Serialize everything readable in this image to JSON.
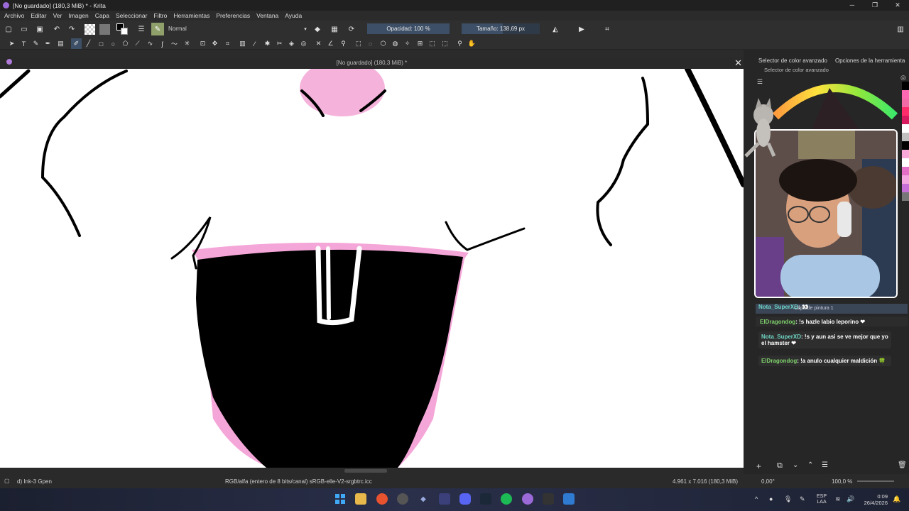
{
  "window": {
    "title": "[No guardado]  (180,3 MiB) * - Krita",
    "minimize": "─",
    "maximize": "❐",
    "close": "✕"
  },
  "menu": [
    "Archivo",
    "Editar",
    "Ver",
    "Imagen",
    "Capa",
    "Seleccionar",
    "Filtro",
    "Herramientas",
    "Preferencias",
    "Ventana",
    "Ayuda"
  ],
  "toolbar": {
    "blend_mode": "Normal",
    "opacity_label": "Opacidad: 100 %",
    "size_label": "Tamaño: 138,69 px"
  },
  "document": {
    "title": "[No guardado]  (180,3 MiB) *",
    "close": "✕"
  },
  "panel": {
    "tab_color": "Selector de color avanzado",
    "tab_tool_options": "Opciones de la herramienta",
    "docker_title": "Selector de color avanzado",
    "layer_name": "Capa de pintura 1"
  },
  "chat": [
    {
      "user": "Nota_SuperXD",
      "text": ": 👀"
    },
    {
      "user": "ElDragondog",
      "text": ": !s hazle labio leporino ❤"
    },
    {
      "user": "Nota_SuperXD",
      "text": ": !s y aun asi se ve mejor que yo el hamster ❤"
    },
    {
      "user": "ElDragondog",
      "text": ": !a anulo cualquier maldición 🍀"
    }
  ],
  "status": {
    "brush": "d) Ink-3 Gpen",
    "color_space": "RGB/alfa (entero de 8 bits/canal)  sRGB-elle-V2-srgbtrc.icc",
    "dimensions": "4.961 x 7.016 (180,3 MiB)",
    "rotation": "0,00°",
    "zoom": "100,0 %"
  },
  "taskbar": {
    "lang1": "ESP",
    "lang2": "LAA",
    "time": "0:09",
    "date": "26/4/2026"
  },
  "colors": {
    "accent": "#3d4f66",
    "pink": "#f4a6d6"
  }
}
